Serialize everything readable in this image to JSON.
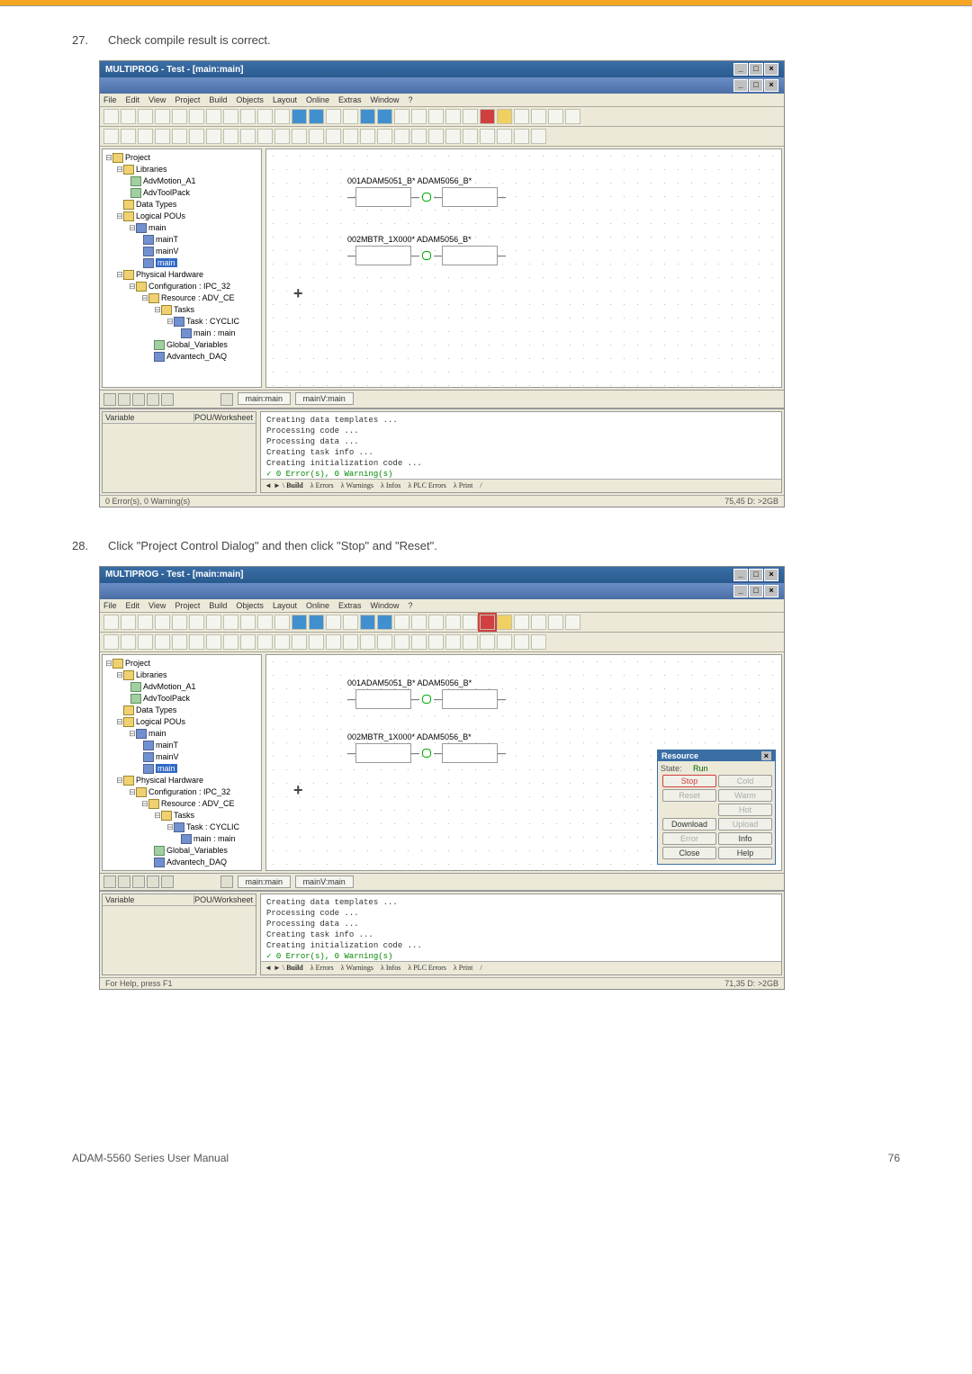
{
  "step27": {
    "num": "27.",
    "text": "Check compile result is correct."
  },
  "step28": {
    "num": "28.",
    "text": "Click \"Project Control Dialog\" and then click \"Stop\" and \"Reset\"."
  },
  "app": {
    "title": "MULTIPROG - Test - [main:main]"
  },
  "menu": [
    "File",
    "Edit",
    "View",
    "Project",
    "Build",
    "Objects",
    "Layout",
    "Online",
    "Extras",
    "Window",
    "?"
  ],
  "tree": {
    "root": "Project",
    "libs": "Libraries",
    "lib1": "AdvMotion_A1",
    "lib2": "AdvToolPack",
    "dt": "Data Types",
    "lpou": "Logical POUs",
    "main": "main",
    "mainT": "mainT",
    "mainV": "mainV",
    "mainI": "main",
    "ph": "Physical Hardware",
    "conf": "Configuration : IPC_32",
    "res": "Resource : ADV_CE",
    "tasks": "Tasks",
    "taskc": "Task : CYCLIC",
    "inst": "main : main",
    "gv": "Global_Variables",
    "daq": "Advantech_DAQ"
  },
  "canvas": {
    "b1": "001ADAM5051_B* ADAM5056_B*",
    "b2": "002MBTR_1X000* ADAM5056_B*"
  },
  "tabs": {
    "t1": "main:main",
    "t2": "mainV:main"
  },
  "varhdr": {
    "c1": "Variable",
    "c2": "POU/Worksheet"
  },
  "output": {
    "l1": "Creating data templates ...",
    "l2": "Processing code ...",
    "l3": "Processing data ...",
    "l4": "Creating task info ...",
    "l5": "Creating initialization code ...",
    "l6": "0 Error(s), 0 Warning(s)",
    "tbuild": "Build",
    "terr": "Errors",
    "twarn": "Warnings",
    "tinfo": "Infos",
    "tplc": "PLC Errors",
    "tprint": "Print"
  },
  "status1": {
    "l": "0 Error(s), 0 Warning(s)",
    "r": "75,45  D: >2GB"
  },
  "status2": {
    "l": "For Help, press F1",
    "r": "71,35  D: >2GB"
  },
  "resdlg": {
    "title": "Resource",
    "state_l": "State:",
    "state_v": "Run",
    "stop": "Stop",
    "cold": "Cold",
    "reset": "Reset",
    "warm": "Warm",
    "hot": "Hot",
    "download": "Download",
    "upload": "Upload",
    "error": "Error",
    "info": "Info",
    "close": "Close",
    "help": "Help"
  },
  "footer": {
    "l": "ADAM-5560 Series User Manual",
    "r": "76"
  }
}
